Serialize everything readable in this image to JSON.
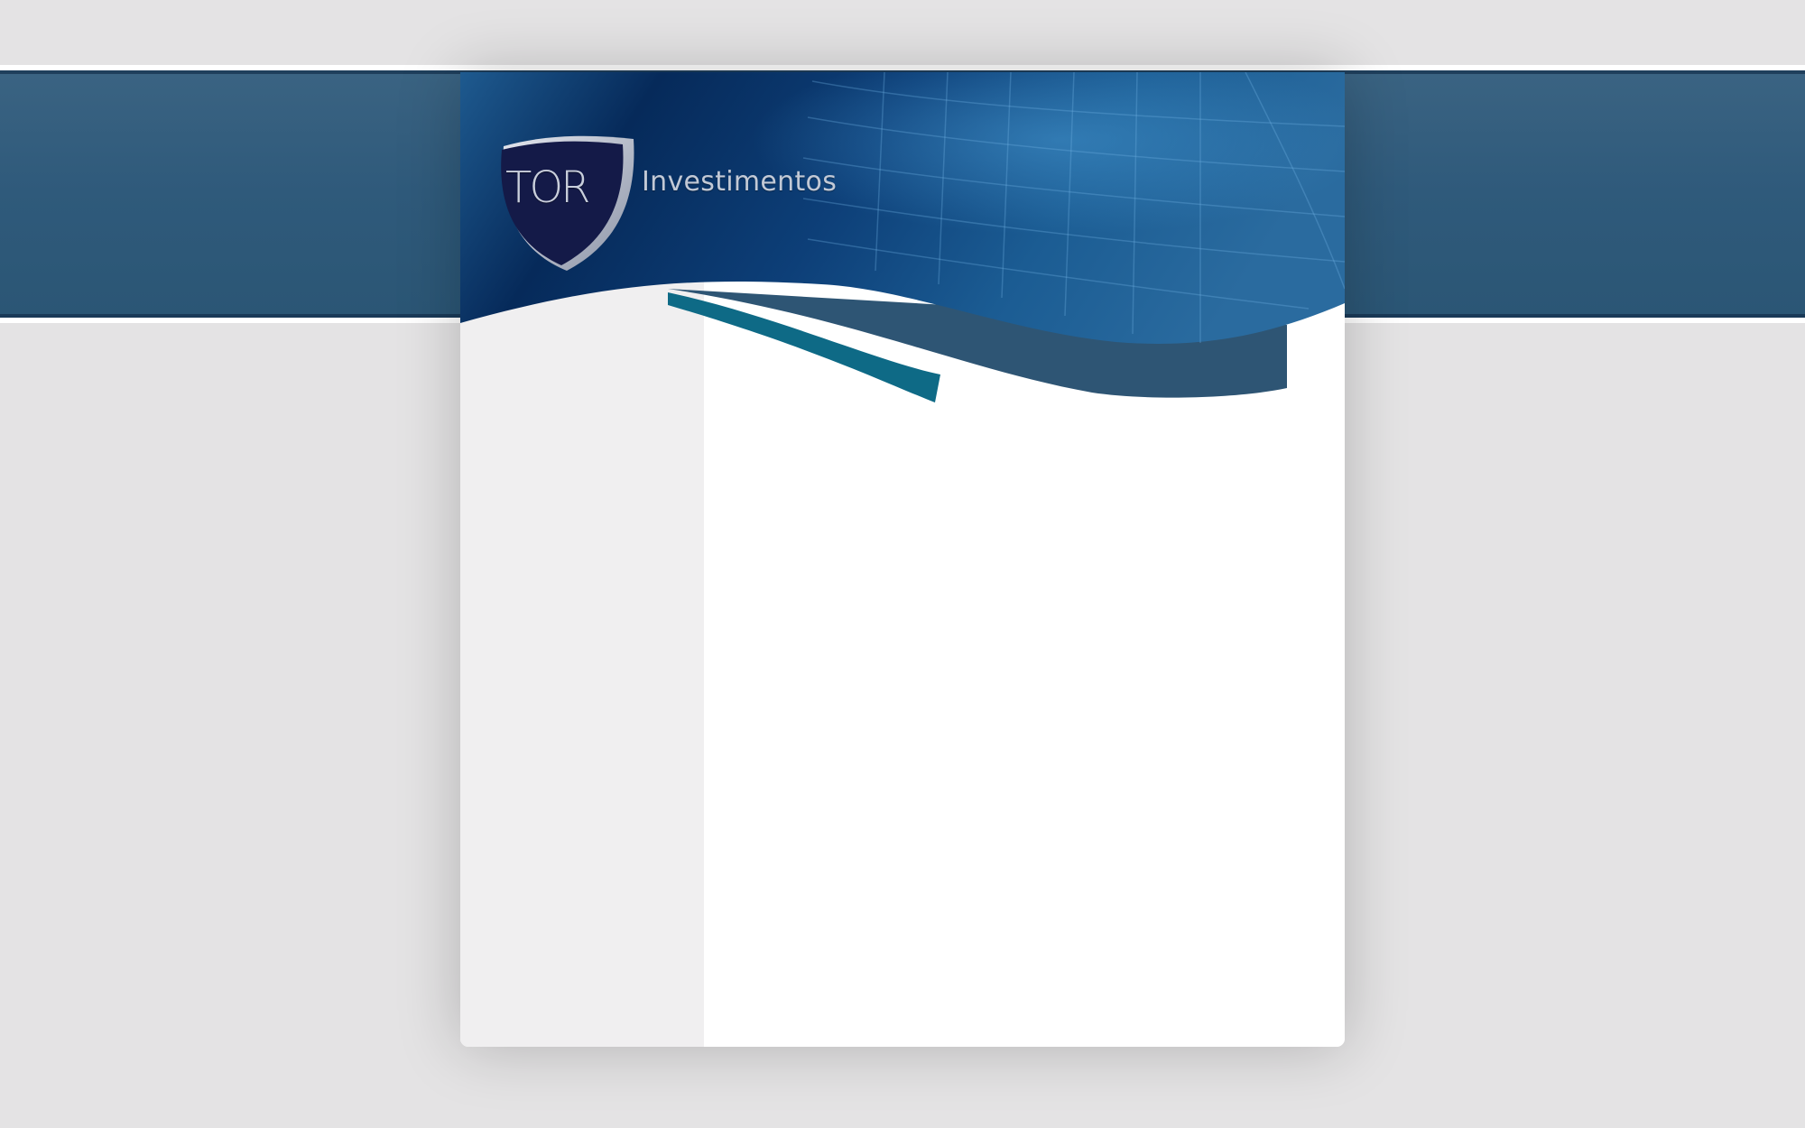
{
  "brand": {
    "name": "TOR",
    "tagline": "Investimentos"
  },
  "colors": {
    "page_background": "#e4e3e4",
    "header_band": "#2f5a7b",
    "header_dark": "#0a2a55",
    "shield": "#141a48",
    "accent_teal": "#0e6a86",
    "sidebar": "#f0eff0",
    "content": "#ffffff"
  },
  "icons": {
    "logo": "shield-logo-icon"
  }
}
